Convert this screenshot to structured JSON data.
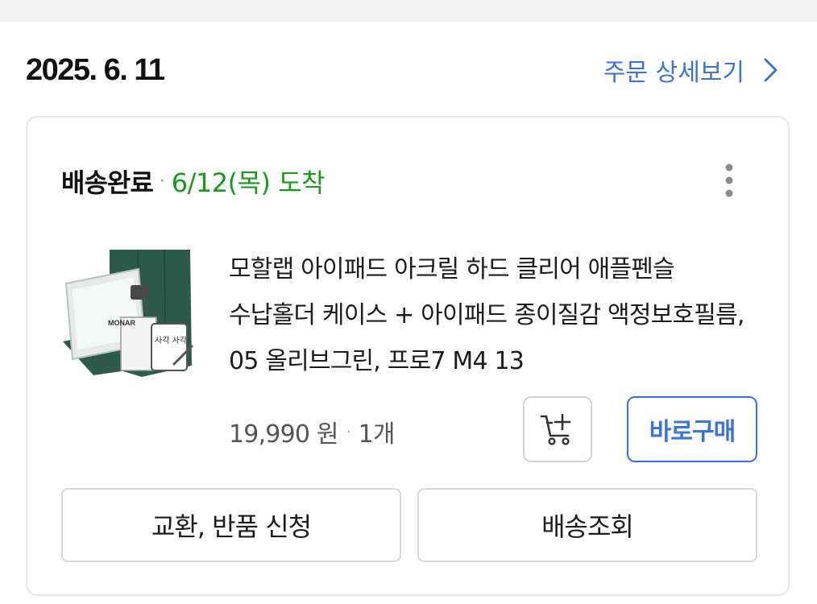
{
  "order": {
    "date": "2025. 6. 11",
    "detail_link": "주문 상세보기"
  },
  "shipment": {
    "status": "배송완료",
    "separator": "·",
    "arrival": "6/12(목) 도착"
  },
  "product": {
    "title": "모할랩 아이패드 아크릴 하드 클리어 애플펜슬 수납홀더 케이스 + 아이패드 종이질감 액정보호필름, 05 올리브그린, 프로7 M4 13",
    "price": "19,990 원",
    "separator": "·",
    "quantity": "1개",
    "thumb_brand_text": "MONAR",
    "thumb_handwriting": "사각 사각"
  },
  "buttons": {
    "add_to_cart": "cart-plus-icon",
    "buy_now": "바로구매",
    "exchange_return": "교환, 반품 신청",
    "track_delivery": "배송조회"
  },
  "colors": {
    "accent_blue": "#3a73d9",
    "delivered_green": "#1a9a1a",
    "case_green": "#2e5a4c"
  }
}
